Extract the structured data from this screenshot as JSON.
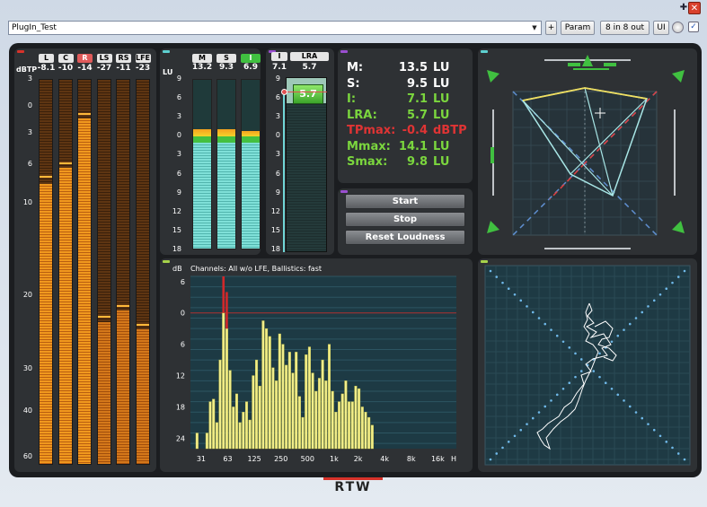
{
  "window": {
    "pin_glyph": "✚",
    "close_glyph": "✕"
  },
  "toolbar": {
    "preset": "PlugIn_Test",
    "add_label": "+",
    "param_label": "Param",
    "routing_label": "8 in 8 out",
    "ui_label": "UI",
    "check_glyph": "✓"
  },
  "colors": {
    "accent_red": "#d7322a",
    "meter_orange": "#f0981e",
    "meter_green": "#40c040",
    "text_green": "#7bd63e",
    "text_red": "#e03434",
    "trace_cyan": "#a8e6e6",
    "trace_yellow": "#f0e060"
  },
  "ppm": {
    "unit": "dBTP",
    "scale": [
      "3",
      "0",
      "3",
      "6",
      "10",
      "20",
      "30",
      "40",
      "60"
    ],
    "channels": [
      {
        "name": "L",
        "value": "-8.1",
        "level": 0.73,
        "peak": 0.745,
        "highlight": false
      },
      {
        "name": "C",
        "value": "-10",
        "level": 0.77,
        "peak": 0.78,
        "highlight": false
      },
      {
        "name": "R",
        "value": "-14",
        "level": 0.9,
        "peak": 0.91,
        "highlight": true
      },
      {
        "name": "LS",
        "value": "-27",
        "level": 0.37,
        "peak": 0.38,
        "highlight": false
      },
      {
        "name": "RS",
        "value": "-11",
        "level": 0.4,
        "peak": 0.41,
        "highlight": false
      },
      {
        "name": "LFE",
        "value": "-23",
        "level": 0.35,
        "peak": 0.36,
        "highlight": false
      }
    ]
  },
  "loudness_bars": {
    "unit": "LU",
    "scale": [
      "9",
      "6",
      "3",
      "0",
      "3",
      "6",
      "9",
      "12",
      "15",
      "18"
    ],
    "channels": [
      {
        "name": "M",
        "value": "13.2",
        "level": 0.7,
        "active": false
      },
      {
        "name": "S",
        "value": "9.3",
        "level": 0.7,
        "active": false
      },
      {
        "name": "I",
        "value": "6.9",
        "level": 0.69,
        "active": true
      }
    ]
  },
  "lra_meter": {
    "i_label": "I",
    "i_value": "7.1",
    "lra_label": "LRA",
    "lra_value": "5.7",
    "box_value": "5.7",
    "scale": [
      "9",
      "6",
      "3",
      "0",
      "3",
      "6",
      "9",
      "12",
      "15",
      "18"
    ]
  },
  "readout": {
    "rows": [
      {
        "label": "M:",
        "value": "13.5",
        "unit": "LU",
        "color": "#ffffff"
      },
      {
        "label": "S:",
        "value": "9.5",
        "unit": "LU",
        "color": "#ffffff"
      },
      {
        "label": "I:",
        "value": "7.1",
        "unit": "LU",
        "color": "#7bd63e"
      },
      {
        "label": "LRA:",
        "value": "5.7",
        "unit": "LU",
        "color": "#7bd63e"
      },
      {
        "label": "TPmax:",
        "value": "-0.4",
        "unit": "dBTP",
        "color": "#e03434"
      },
      {
        "label": "Mmax:",
        "value": "14.1",
        "unit": "LU",
        "color": "#7bd63e"
      },
      {
        "label": "Smax:",
        "value": "9.8",
        "unit": "LU",
        "color": "#7bd63e"
      }
    ]
  },
  "controls": {
    "start": "Start",
    "stop": "Stop",
    "reset": "Reset Loudness"
  },
  "rta": {
    "caption": "Channels: All w/o LFE, Ballistics: fast",
    "unit": "dB",
    "y_ticks": [
      "6",
      "0",
      "6",
      "12",
      "18",
      "24"
    ],
    "x_ticks": [
      "31",
      "63",
      "125",
      "250",
      "500",
      "1k",
      "2k",
      "4k",
      "8k",
      "16k"
    ],
    "x_unit": "H",
    "bars": [
      2,
      0,
      0,
      2,
      14,
      15,
      6,
      30,
      48,
      42,
      26,
      12,
      17,
      6,
      10,
      14,
      7,
      24,
      30,
      20,
      45,
      42,
      39,
      27,
      22,
      40,
      36,
      28,
      33,
      25,
      33,
      16,
      8,
      32,
      35,
      25,
      18,
      23,
      30,
      22,
      36,
      18,
      10,
      14,
      17,
      22,
      14,
      14,
      20,
      19,
      12,
      10,
      8,
      5
    ],
    "peaks": [
      0,
      0,
      0,
      0,
      0,
      0,
      0,
      0,
      62,
      56,
      0,
      0,
      0,
      0,
      0,
      0,
      0,
      0,
      0,
      0,
      0,
      0,
      0,
      0,
      0,
      0,
      0,
      0,
      0,
      0,
      0,
      0,
      0,
      0,
      0,
      0,
      0,
      0,
      0,
      0,
      0,
      0,
      0,
      0,
      0,
      0,
      0,
      0,
      0,
      0,
      0,
      0,
      0,
      0
    ]
  }
}
